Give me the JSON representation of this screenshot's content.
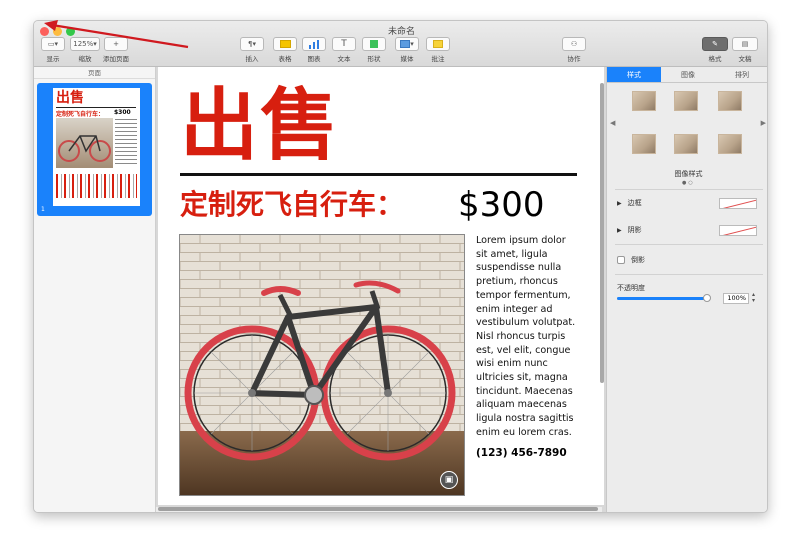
{
  "window": {
    "title": "未命名"
  },
  "toolbar": {
    "view_label": "显示",
    "zoom_value": "125%",
    "zoom_label": "缩放",
    "add_page_label": "添加页面",
    "insert_label": "插入",
    "table_label": "表格",
    "chart_label": "图表",
    "text_label": "文本",
    "shape_label": "形状",
    "media_label": "媒体",
    "comment_label": "批注",
    "collaborate_label": "协作",
    "format_label": "格式",
    "document_label": "文稿"
  },
  "sidebar": {
    "header": "页面",
    "page_number": "1"
  },
  "document": {
    "heading": "出售",
    "subheading": "定制死飞自行车：",
    "price": "$300",
    "body": "Lorem ipsum dolor sit amet, ligula suspendisse nulla pretium, rhoncus tempor fermentum, enim integer ad vestibulum volutpat. Nisl rhoncus turpis est, vel elit, congue wisi enim nunc ultricies sit, magna tincidunt. Maecenas aliquam maecenas ligula nostra sagittis enim eu lorem cras.",
    "phone": "(123) 456-7890"
  },
  "inspector": {
    "tabs": [
      "样式",
      "图像",
      "排列"
    ],
    "image_styles_label": "图像样式",
    "border_label": "边框",
    "shadow_label": "阴影",
    "reflection_label": "倒影",
    "opacity_label": "不透明度",
    "opacity_value": "100%",
    "opacity_level": 1.0
  },
  "colors": {
    "accent": "#1a82fb",
    "heading_red": "#d71f0f",
    "arrow_red": "#d0191f"
  }
}
